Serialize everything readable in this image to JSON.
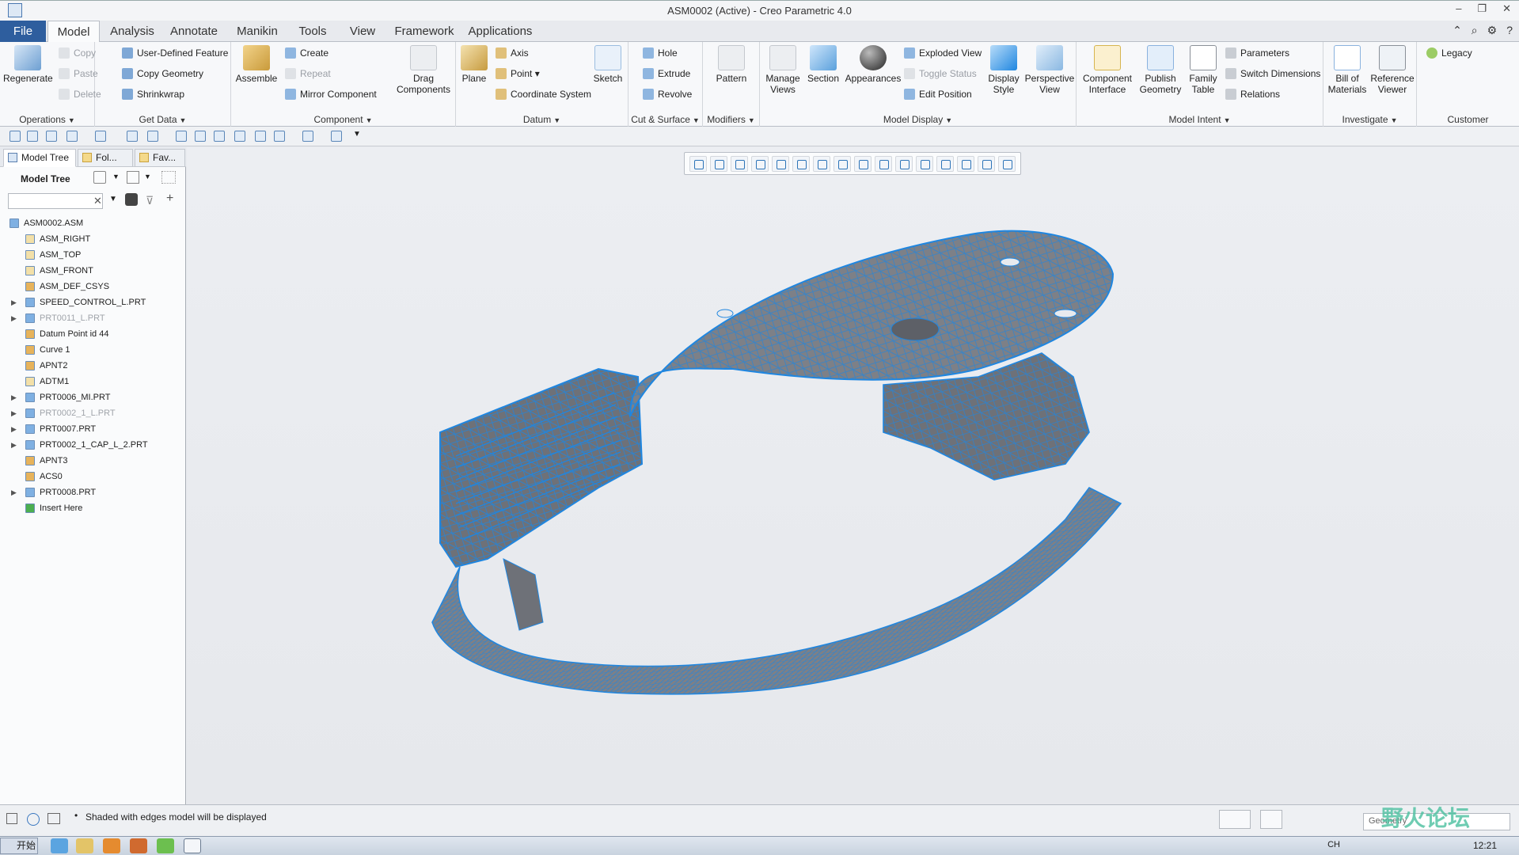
{
  "window": {
    "title": "ASM0002 (Active) - Creo Parametric 4.0"
  },
  "tabs": [
    "File",
    "Model",
    "Analysis",
    "Annotate",
    "Manikin",
    "Tools",
    "View",
    "Framework",
    "Applications"
  ],
  "active_tab": "Model",
  "ribbon": {
    "operations": {
      "label": "Operations",
      "regenerate": "Regenerate",
      "copy": "Copy",
      "paste": "Paste",
      "delete": "Delete"
    },
    "get_data": {
      "label": "Get Data",
      "udf": "User-Defined Feature",
      "copy_geometry": "Copy Geometry",
      "shrinkwrap": "Shrinkwrap"
    },
    "component": {
      "label": "Component",
      "assemble": "Assemble",
      "create": "Create",
      "repeat": "Repeat",
      "mirror": "Mirror Component",
      "drag_1": "Drag",
      "drag_2": "Components"
    },
    "datum": {
      "label": "Datum",
      "plane": "Plane",
      "axis": "Axis",
      "point": "Point",
      "csys": "Coordinate System",
      "sketch": "Sketch"
    },
    "cut_surface": {
      "label": "Cut & Surface",
      "hole": "Hole",
      "extrude": "Extrude",
      "revolve": "Revolve"
    },
    "modifiers": {
      "label": "Modifiers",
      "pattern": "Pattern"
    },
    "model_display": {
      "label": "Model Display",
      "manage_views_1": "Manage",
      "manage_views_2": "Views",
      "section": "Section",
      "appearances": "Appearances",
      "exploded_view": "Exploded View",
      "toggle_status": "Toggle Status",
      "edit_position": "Edit Position",
      "display_style_1": "Display",
      "display_style_2": "Style",
      "perspective_1": "Perspective",
      "perspective_2": "View"
    },
    "model_intent": {
      "label": "Model Intent",
      "component_interface_1": "Component",
      "component_interface_2": "Interface",
      "publish_geometry_1": "Publish",
      "publish_geometry_2": "Geometry",
      "family_table_1": "Family",
      "family_table_2": "Table",
      "parameters": "Parameters",
      "switch_dimensions": "Switch Dimensions",
      "relations": "Relations"
    },
    "investigate": {
      "label": "Investigate",
      "bom_1": "Bill of",
      "bom_2": "Materials",
      "ref_viewer_1": "Reference",
      "ref_viewer_2": "Viewer"
    },
    "customer": {
      "label": "Customer",
      "legacy": "Legacy"
    }
  },
  "sidebar": {
    "tabs": [
      "Model Tree",
      "Fol...",
      "Fav..."
    ],
    "header": "Model Tree",
    "tree": [
      {
        "label": "ASM0002.ASM",
        "level": 0,
        "icon": "assembly-icon",
        "expand": false,
        "muted": false
      },
      {
        "label": "ASM_RIGHT",
        "level": 1,
        "icon": "datum-plane-icon",
        "expand": false,
        "muted": false
      },
      {
        "label": "ASM_TOP",
        "level": 1,
        "icon": "datum-plane-icon",
        "expand": false,
        "muted": false
      },
      {
        "label": "ASM_FRONT",
        "level": 1,
        "icon": "datum-plane-icon",
        "expand": false,
        "muted": false
      },
      {
        "label": "ASM_DEF_CSYS",
        "level": 1,
        "icon": "csys-icon",
        "expand": false,
        "muted": false
      },
      {
        "label": "SPEED_CONTROL_L.PRT",
        "level": 1,
        "icon": "part-icon",
        "expand": true,
        "muted": false
      },
      {
        "label": "PRT0011_L.PRT",
        "level": 1,
        "icon": "part-icon",
        "expand": true,
        "muted": true
      },
      {
        "label": "Datum Point id 44",
        "level": 1,
        "icon": "datum-point-icon",
        "expand": false,
        "muted": false
      },
      {
        "label": "Curve 1",
        "level": 1,
        "icon": "curve-icon",
        "expand": false,
        "muted": false
      },
      {
        "label": "APNT2",
        "level": 1,
        "icon": "datum-point-icon",
        "expand": false,
        "muted": false
      },
      {
        "label": "ADTM1",
        "level": 1,
        "icon": "datum-plane-icon",
        "expand": false,
        "muted": false
      },
      {
        "label": "PRT0006_MI.PRT",
        "level": 1,
        "icon": "part-icon",
        "expand": true,
        "muted": false
      },
      {
        "label": "PRT0002_1_L.PRT",
        "level": 1,
        "icon": "part-icon",
        "expand": true,
        "muted": true
      },
      {
        "label": "PRT0007.PRT",
        "level": 1,
        "icon": "part-icon",
        "expand": true,
        "muted": false
      },
      {
        "label": "PRT0002_1_CAP_L_2.PRT",
        "level": 1,
        "icon": "part-icon",
        "expand": true,
        "muted": false
      },
      {
        "label": "APNT3",
        "level": 1,
        "icon": "datum-point-icon",
        "expand": false,
        "muted": false
      },
      {
        "label": "ACS0",
        "level": 1,
        "icon": "csys-icon",
        "expand": false,
        "muted": false
      },
      {
        "label": "PRT0008.PRT",
        "level": 1,
        "icon": "part-icon",
        "expand": true,
        "muted": false
      },
      {
        "label": "Insert Here",
        "level": 1,
        "icon": "insert-arrow-icon",
        "expand": false,
        "muted": false
      }
    ]
  },
  "status": {
    "message": "Shaded with edges model will be displayed",
    "filter": "Geometry"
  },
  "taskbar": {
    "start": "开始",
    "lang": "CH",
    "time": "12:21"
  },
  "watermark": "野火论坛",
  "colors": {
    "accent": "#2e5e9e",
    "edge_blue": "#1f86e0",
    "model_gray": "#7d8087"
  }
}
